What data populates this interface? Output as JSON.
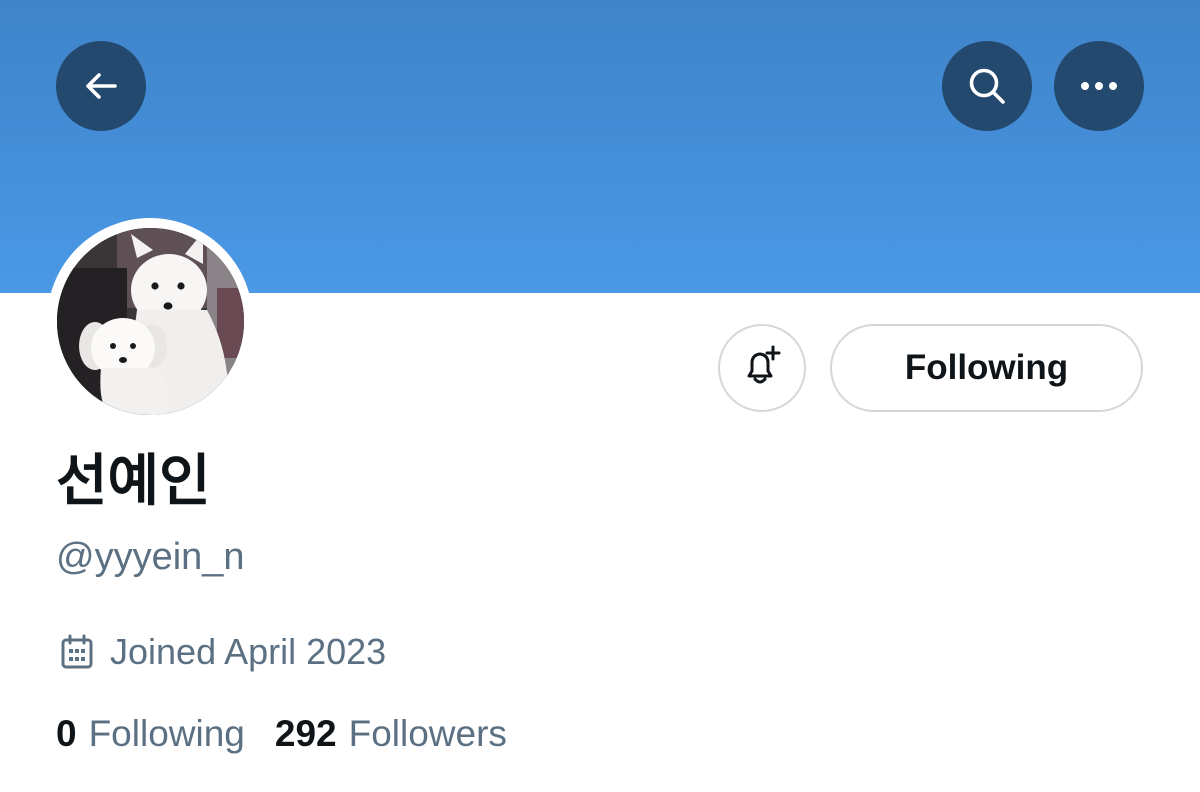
{
  "banner": {
    "color_top": "#3f84c9",
    "color_bottom": "#4a98e6"
  },
  "header": {
    "back_icon": "arrow-left-icon",
    "search_icon": "search-icon",
    "more_icon": "more-horizontal-icon"
  },
  "profile": {
    "display_name": "선예인",
    "handle": "@yyyein_n",
    "joined": "Joined April 2023",
    "avatar_description": "two-white-dogs-photo"
  },
  "actions": {
    "notify_icon": "bell-plus-icon",
    "follow_label": "Following"
  },
  "stats": {
    "following_count": "0",
    "following_label": "Following",
    "followers_count": "292",
    "followers_label": "Followers"
  },
  "colors": {
    "text_primary": "#0f1419",
    "text_secondary": "#5b7083",
    "button_border": "#d3d8dd",
    "header_button_bg": "#23496e"
  }
}
